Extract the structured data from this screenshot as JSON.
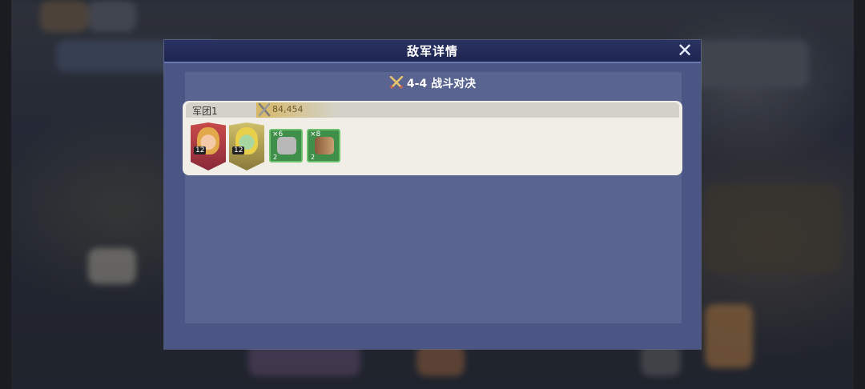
{
  "modal": {
    "title": "敌军详情",
    "close_label": "✕",
    "subtitle": "4-4 战斗对决"
  },
  "legion": {
    "name": "军团1",
    "power": "84,454",
    "heroes": [
      {
        "level": "12",
        "icon": "hero-portrait-icon"
      },
      {
        "level": "12",
        "icon": "hero-portrait-icon"
      }
    ],
    "troops": [
      {
        "count": "×6",
        "tier": "2",
        "icon": "wolf-troop-icon"
      },
      {
        "count": "×8",
        "tier": "2",
        "icon": "drill-troop-icon"
      }
    ]
  },
  "colors": {
    "header_bg": "#1e2550",
    "panel_bg": "#4b5684",
    "card_bg": "#f0eee6",
    "troop_border": "#6ec26e",
    "power_gold": "#d6b45a"
  }
}
